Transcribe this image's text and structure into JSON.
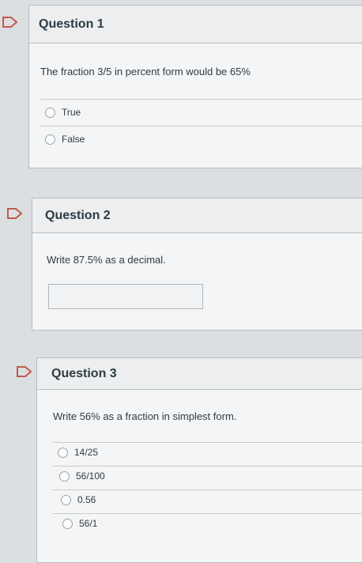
{
  "colors": {
    "flag_accent": "#c15a4a",
    "background": "#dcdfe1",
    "card": "#f4f5f6"
  },
  "questions": [
    {
      "title": "Question 1",
      "prompt": "The fraction 3/5 in percent form would be 65%",
      "options": [
        "True",
        "False"
      ]
    },
    {
      "title": "Question 2",
      "prompt": "Write 87.5% as a decimal.",
      "answer_value": ""
    },
    {
      "title": "Question 3",
      "prompt": "Write 56% as a fraction in simplest form.",
      "options": [
        "14/25",
        "56/100",
        "0.56",
        "56/1"
      ]
    }
  ]
}
